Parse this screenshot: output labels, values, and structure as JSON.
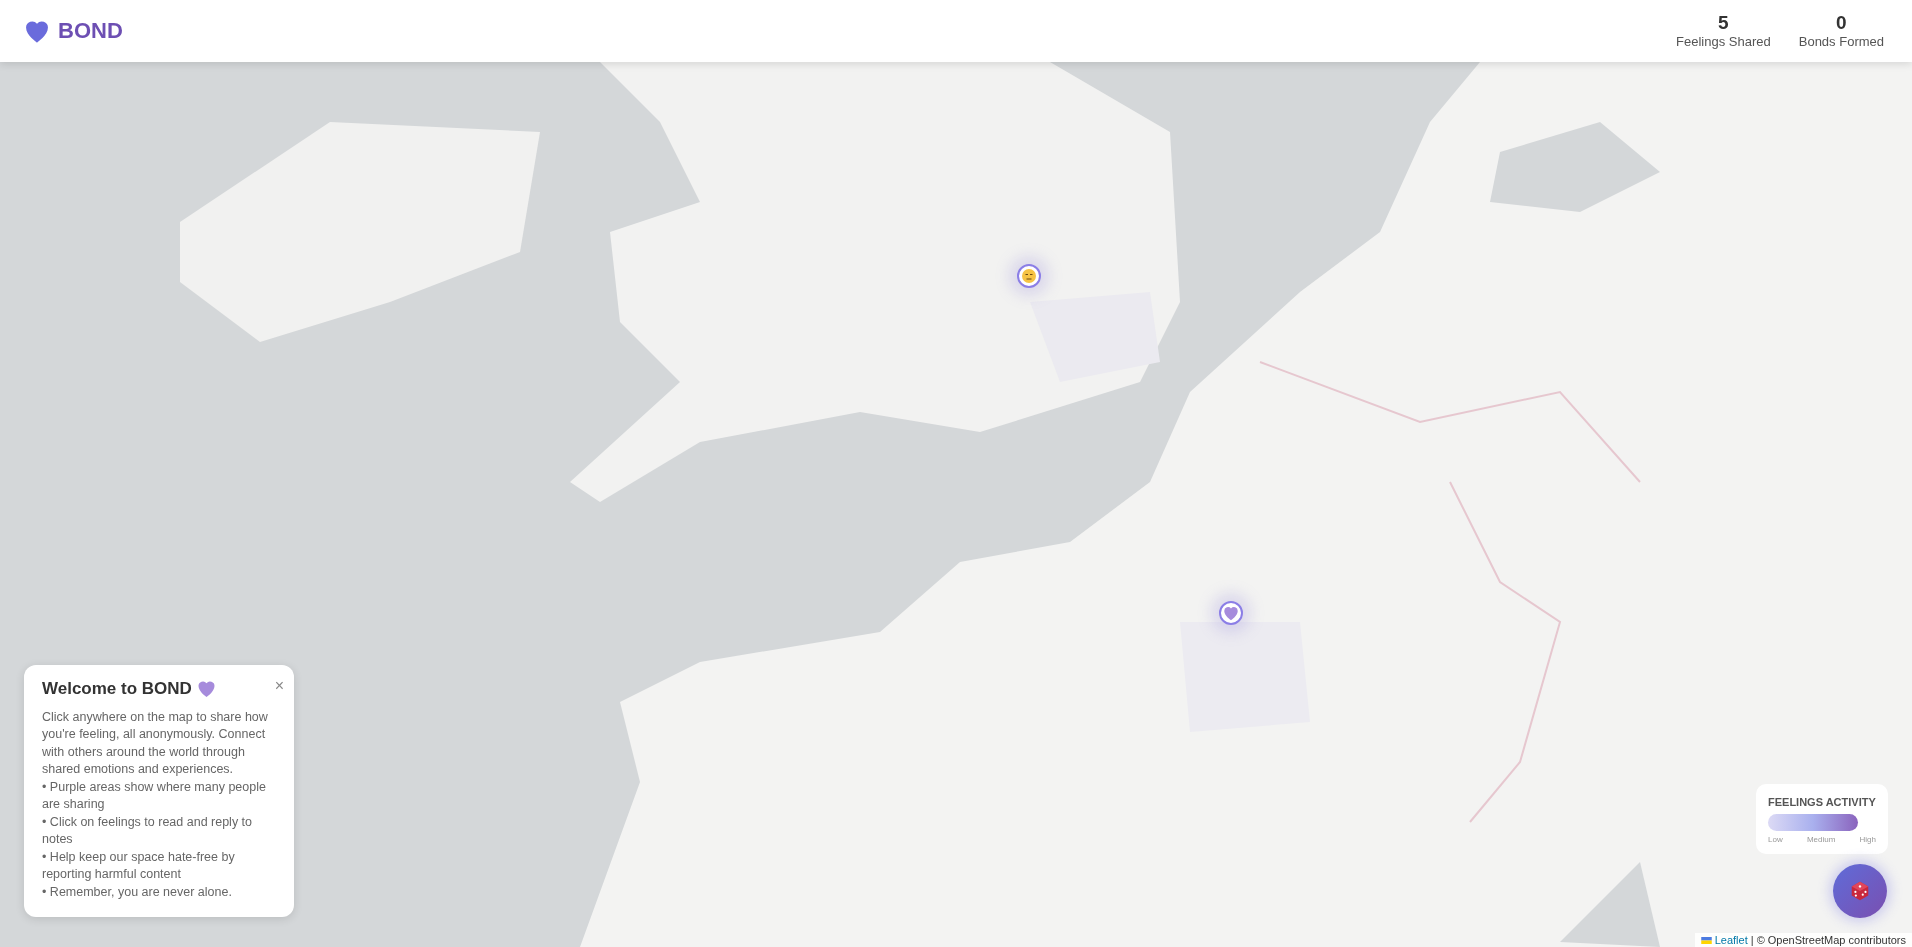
{
  "app": {
    "logo": "BOND"
  },
  "stats": [
    {
      "value": "5",
      "label": "Feelings Shared"
    },
    {
      "value": "0",
      "label": "Bonds Formed"
    }
  ],
  "map": {
    "kind": "picture",
    "markers": [
      {
        "kind": "face"
      },
      {
        "kind": "heart"
      }
    ]
  },
  "welcome": {
    "title": "Welcome to BOND",
    "close": "×",
    "paragraphs": [
      "Click anywhere on the map to share how you're feeling, all anonymously. Connect with others around the world through shared emotions and experiences.",
      "• Purple areas show where many people are sharing",
      "• Click on feelings to read and reply to notes",
      "• Help keep our space hate-free by reporting harmful content",
      "• Remember, you are never alone."
    ]
  },
  "legend": {
    "title": "FEELINGS ACTIVITY",
    "labels": [
      "Low",
      "Medium",
      "High"
    ]
  },
  "attribution": {
    "link": "Leaflet",
    "text": "| © OpenStreetMap contributors"
  }
}
